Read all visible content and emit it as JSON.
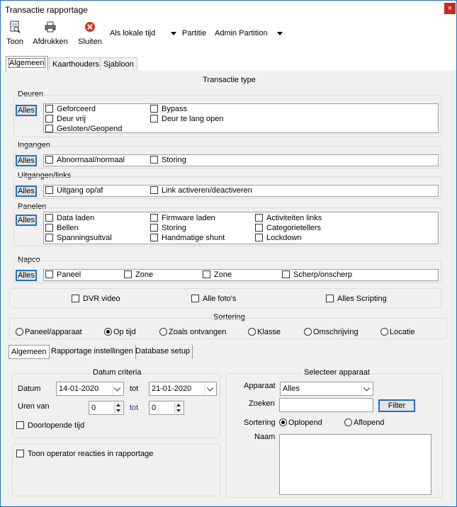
{
  "window": {
    "title": "Transactie rapportage",
    "close": "×"
  },
  "toolbar": {
    "toon": "Toon",
    "afdrukken": "Afdrukken",
    "sluiten": "Sluiten",
    "time_select": "Als lokale tijd",
    "partitie_label": "Partitie",
    "partition_select": "Admin Partition"
  },
  "tabs_top": [
    "Algemeen",
    "Kaarthouders",
    "Sjabloon"
  ],
  "transactie_type": {
    "title": "Transactie type",
    "alles": "Alles",
    "deuren": {
      "label": "Deuren",
      "items": [
        "Geforceerd",
        "Deur vrij",
        "Gesloten/Geopend",
        "Bypass",
        "Deur te lang open"
      ]
    },
    "ingangen": {
      "label": "Ingangen",
      "items": [
        "Abnormaal/normaal",
        "Storing"
      ]
    },
    "uitgangen": {
      "label": "Uitgangen/links",
      "items": [
        "Uitgang op/af",
        "Link activeren/deactiveren"
      ]
    },
    "panelen": {
      "label": "Panelen",
      "items": [
        "Data laden",
        "Bellen",
        "Spanningsuitval",
        "Firmware laden",
        "Storing",
        "Handmatige shunt",
        "Activiteiten links",
        "Categorietellers",
        "Lockdown"
      ]
    },
    "napco": {
      "label": "Napco",
      "items": [
        "Paneel",
        "Zone",
        "Zone",
        "Scherp/onscherp"
      ]
    },
    "extra": [
      "DVR video",
      "Alle foto's",
      "Alles Scripting"
    ]
  },
  "sortering": {
    "title": "Sortering",
    "options": [
      "Paneel/apparaat",
      "Op tijd",
      "Zoals ontvangen",
      "Klasse",
      "Omschrijving",
      "Locatie"
    ],
    "selected": "Op tijd"
  },
  "tabs_bottom": [
    "Algemeen",
    "Rapportage instellingen",
    "Database setup"
  ],
  "datum_criteria": {
    "title": "Datum criteria",
    "datum_label": "Datum",
    "from": "14-01-2020",
    "tot_label": "tot",
    "to": "21-01-2020",
    "uren_label": "Uren van",
    "uren_from": "0",
    "uren_tot_label": "tot",
    "uren_to": "0",
    "doorlopende": "Doorlopende tijd"
  },
  "toon_operator": "Toon operator reacties in rapportage",
  "selecteer": {
    "title": "Selecteer apparaat",
    "apparaat_label": "Apparaat",
    "apparaat_value": "Alles",
    "zoeken_label": "Zoeken",
    "zoeken_value": "",
    "filter": "Filter",
    "sortering_label": "Sortering",
    "oplopend": "Oplopend",
    "aflopend": "Aflopend",
    "naam_label": "Naam"
  },
  "colors": {
    "accent": "#1e6fd0",
    "close": "#c42b1c"
  }
}
